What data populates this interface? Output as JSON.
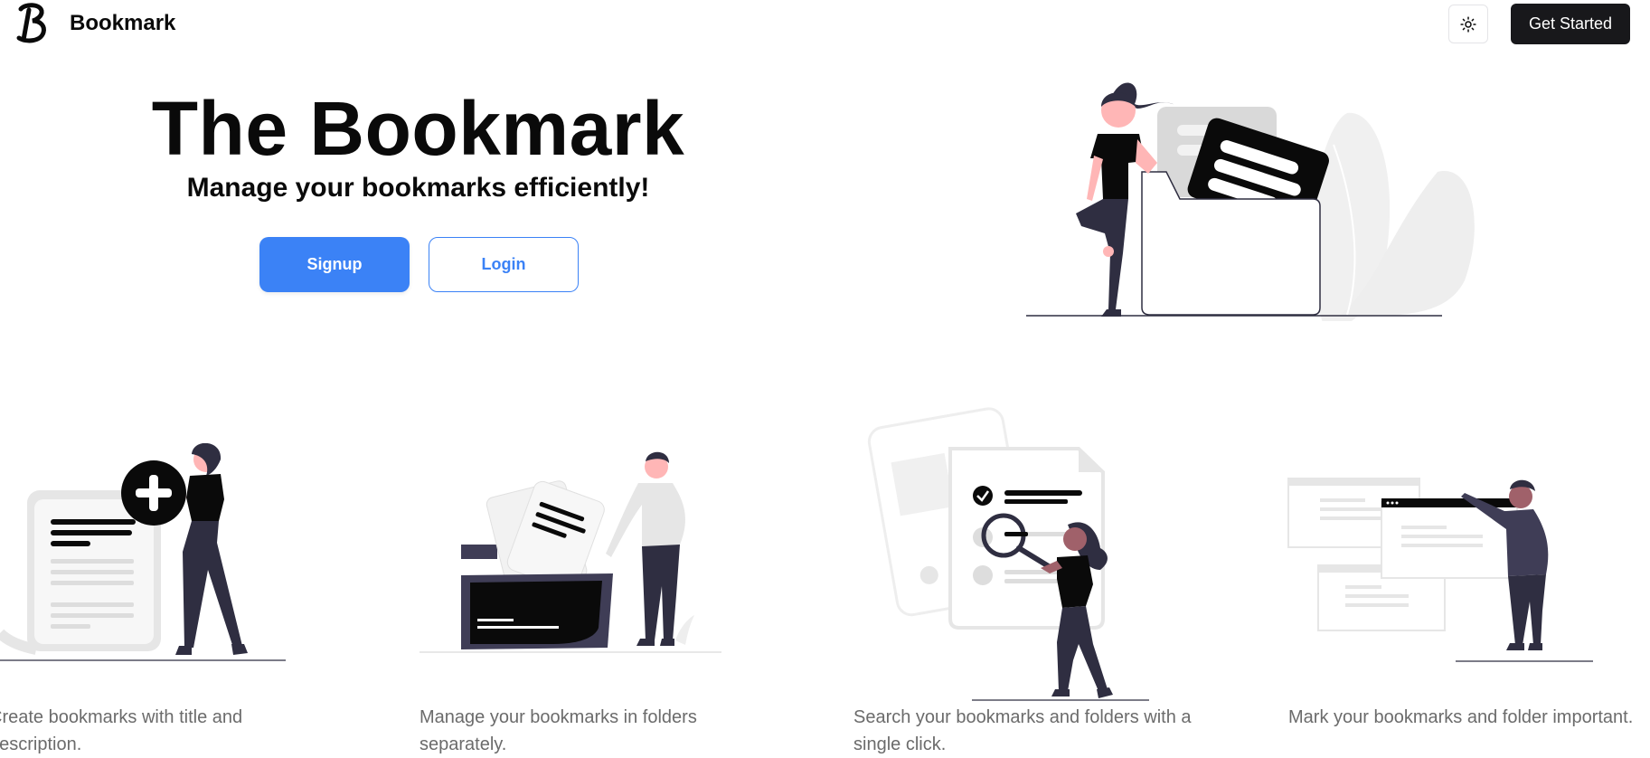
{
  "nav": {
    "brand": "Bookmark",
    "logo_icon": "bookmark-logo-icon",
    "theme_toggle_icon": "sun-icon",
    "get_started_label": "Get Started"
  },
  "hero": {
    "title": "The Bookmark",
    "subtitle": "Manage your bookmarks efficiently!",
    "signup_label": "Signup",
    "login_label": "Login",
    "illustration": "person-with-folder-illustration"
  },
  "features": [
    {
      "text": "Create bookmarks with title and description.",
      "illustration": "add-document-illustration"
    },
    {
      "text": "Manage your bookmarks in folders separately.",
      "illustration": "folder-files-illustration"
    },
    {
      "text": "Search your bookmarks and folders with a single click.",
      "illustration": "search-document-illustration"
    },
    {
      "text": "Mark your bookmarks and folder important.",
      "illustration": "browser-windows-illustration"
    }
  ],
  "colors": {
    "primary": "#3b82f6",
    "dark": "#18181b",
    "illustration_dark": "#2f2e41",
    "skin": "#ffb6b6",
    "muted_text": "#6b6b6b"
  }
}
